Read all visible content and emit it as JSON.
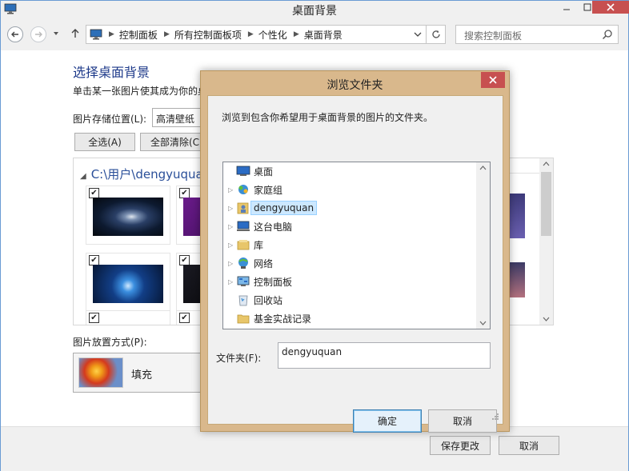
{
  "window": {
    "title": "桌面背景"
  },
  "nav": {
    "breadcrumb": [
      "控制面板",
      "所有控制面板项",
      "个性化",
      "桌面背景"
    ],
    "search_placeholder": "搜索控制面板"
  },
  "page": {
    "heading": "选择桌面背景",
    "subtitle": "单击某一张图片使其成为你的桌",
    "location_label": "图片存储位置(L):",
    "location_value": "高清壁纸",
    "select_all": "全选(A)",
    "clear_all": "全部清除(C",
    "gallery_path": "C:\\用户\\dengyuquan",
    "position_label": "图片放置方式(P):",
    "position_value": "填充"
  },
  "footer": {
    "save": "保存更改",
    "cancel": "取消"
  },
  "dialog": {
    "title": "浏览文件夹",
    "description": "浏览到包含你希望用于桌面背景的图片的文件夹。",
    "tree": [
      {
        "label": "桌面",
        "icon": "desktop-icon",
        "expandable": false,
        "selected": false
      },
      {
        "label": "家庭组",
        "icon": "homegroup-icon",
        "expandable": true,
        "selected": false
      },
      {
        "label": "dengyuquan",
        "icon": "user-folder-icon",
        "expandable": true,
        "selected": true
      },
      {
        "label": "这台电脑",
        "icon": "computer-icon",
        "expandable": true,
        "selected": false
      },
      {
        "label": "库",
        "icon": "library-icon",
        "expandable": true,
        "selected": false
      },
      {
        "label": "网络",
        "icon": "network-icon",
        "expandable": true,
        "selected": false
      },
      {
        "label": "控制面板",
        "icon": "control-panel-icon",
        "expandable": true,
        "selected": false
      },
      {
        "label": "回收站",
        "icon": "recycle-bin-icon",
        "expandable": false,
        "selected": false
      },
      {
        "label": "基金实战记录",
        "icon": "folder-icon",
        "expandable": false,
        "selected": false
      }
    ],
    "folder_label": "文件夹(F):",
    "folder_value": "dengyuquan",
    "ok": "确定",
    "cancel": "取消"
  },
  "colors": {
    "dialog_frame": "#d9b88c",
    "close_red": "#c75050",
    "heading_blue": "#1e3a8a",
    "selection": "#cce8ff"
  }
}
